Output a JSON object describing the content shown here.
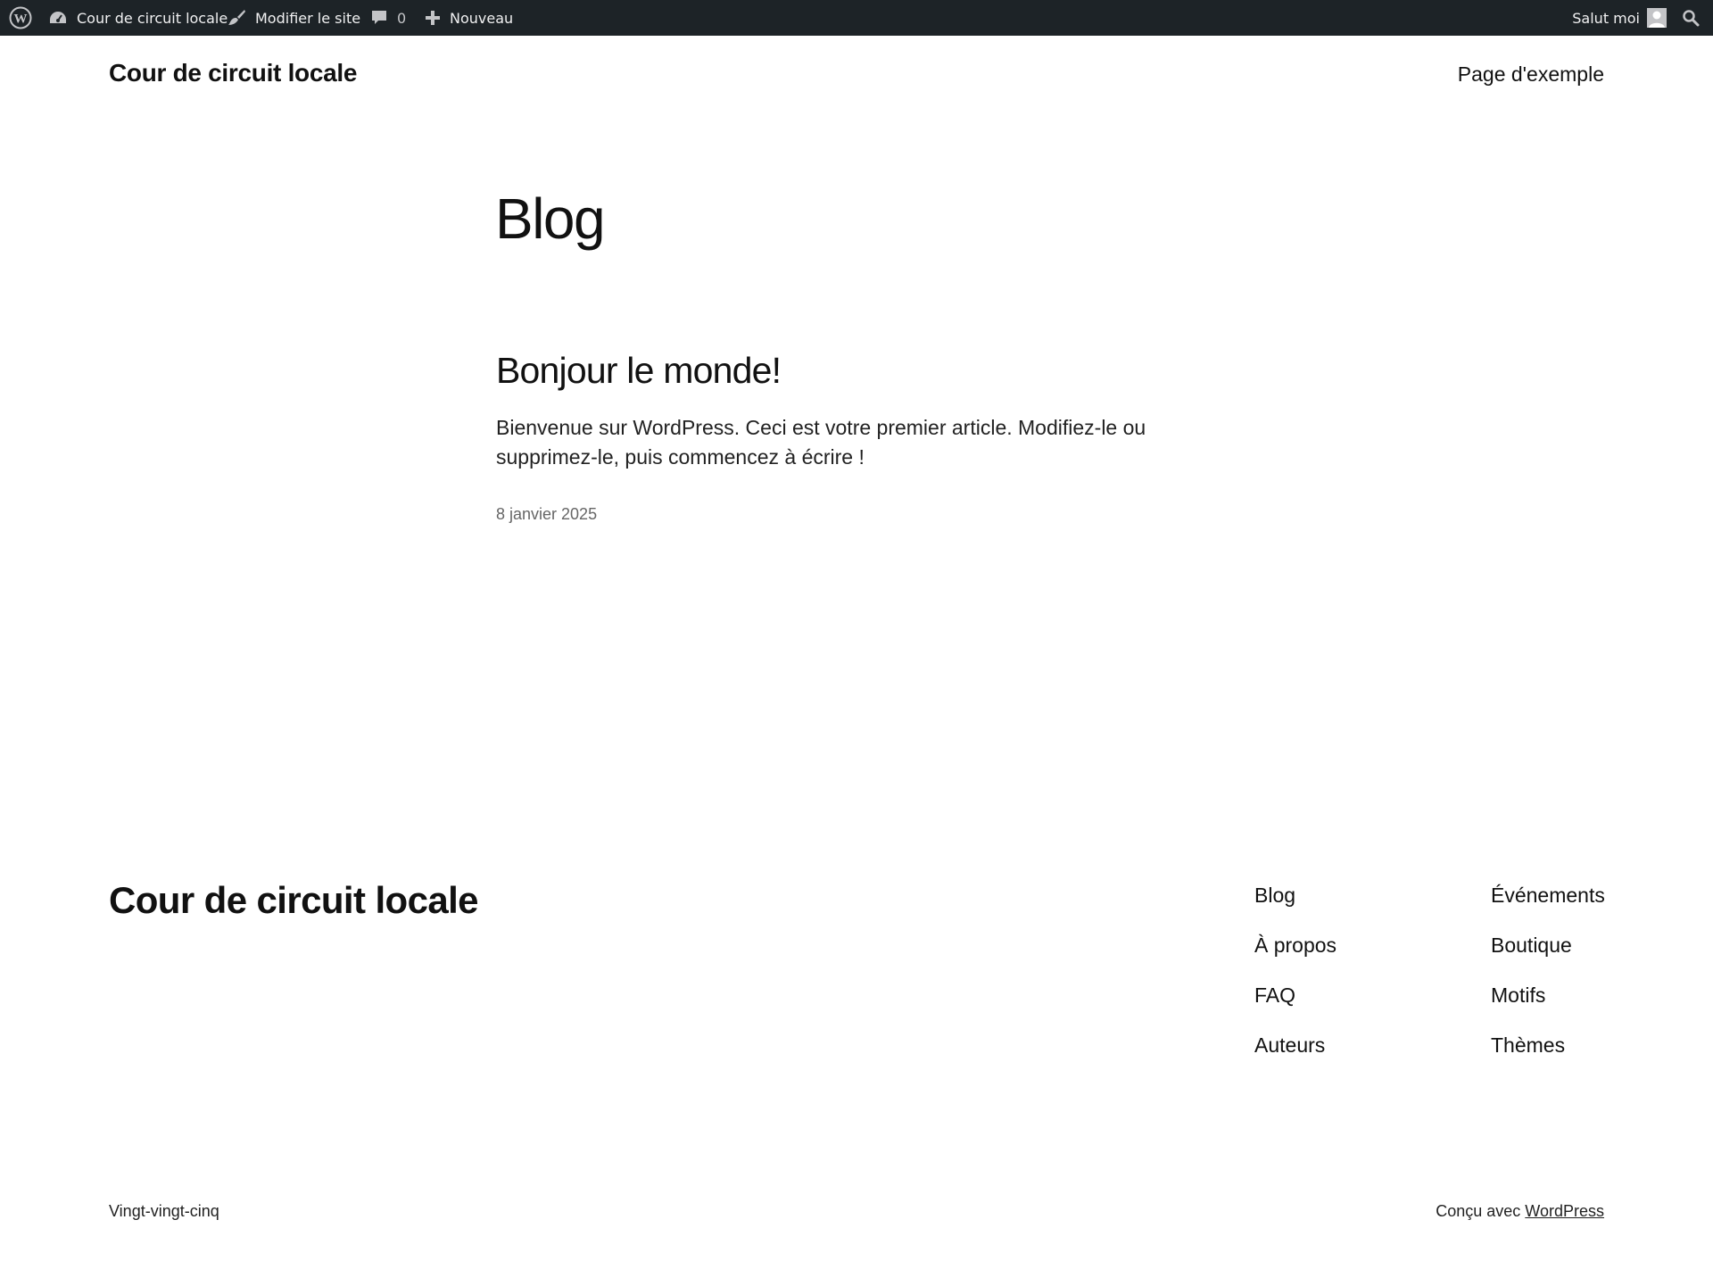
{
  "admin_bar": {
    "wp_logo_icon": "wordpress-logo-icon",
    "site_name": "Cour de circuit locale",
    "edit_site_label": "Modifier le site",
    "comments_count": "0",
    "new_label": "Nouveau",
    "greeting": "Salut moi",
    "search_icon": "search-icon",
    "background_color": "#1d2327",
    "text_color": "#f0f0f1"
  },
  "header": {
    "site_title": "Cour de circuit locale",
    "nav_items": [
      "Page d'exemple"
    ]
  },
  "main": {
    "page_heading": "Blog",
    "posts": [
      {
        "title": "Bonjour le monde!",
        "excerpt": "Bienvenue sur WordPress. Ceci est votre premier article. Modifiez-le ou supprimez-le, puis commencez à écrire !",
        "date": "8 janvier 2025"
      }
    ]
  },
  "footer": {
    "site_title": "Cour de circuit locale",
    "nav_column_1": [
      "Blog",
      "À propos",
      "FAQ",
      "Auteurs"
    ],
    "nav_column_2": [
      "Événements",
      "Boutique",
      "Motifs",
      "Thèmes"
    ],
    "theme_name": "Vingt-vingt-cinq",
    "credit_prefix": "Conçu avec ",
    "credit_link": "WordPress"
  }
}
